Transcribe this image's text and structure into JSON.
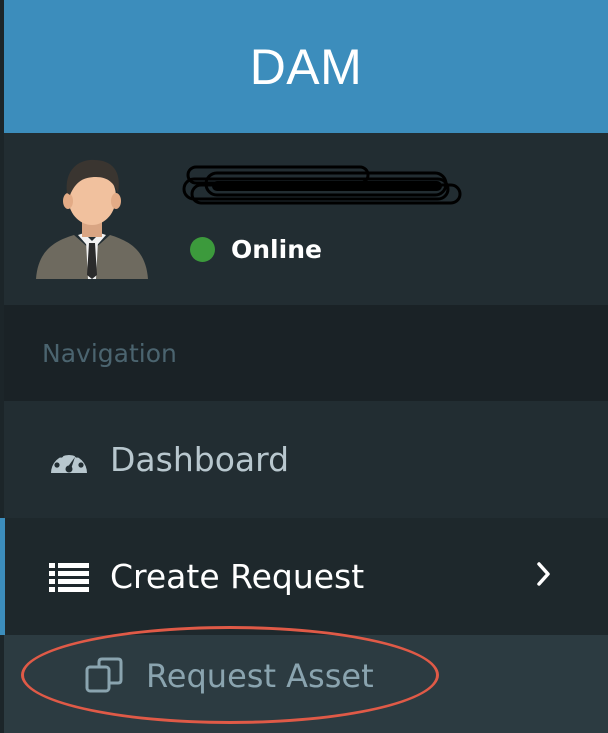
{
  "app": {
    "logo_text": "DAM"
  },
  "user_panel": {
    "status_text": "Online",
    "status_color": "#3c9a3c"
  },
  "navigation": {
    "header": "Navigation",
    "items": [
      {
        "label": "Dashboard",
        "icon": "dashboard-gauge-icon"
      },
      {
        "label": "Create Request",
        "icon": "list-icon",
        "active": true,
        "expanded": true
      }
    ],
    "submenu": [
      {
        "label": "Request Asset",
        "icon": "copy-clone-icon"
      }
    ]
  },
  "colors": {
    "header_bg": "#3c8dbc",
    "sidebar_bg": "#222d32",
    "active_border": "#3c8dbc",
    "annotation": "#e05a47"
  }
}
